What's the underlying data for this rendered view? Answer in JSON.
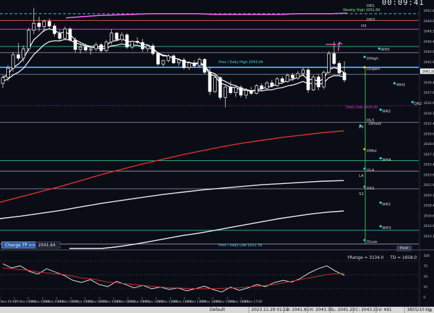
{
  "clock": "00:09:41",
  "toolbar": {
    "change_tp_label": "Change TP >>",
    "tp_value": "2041.64",
    "pivot_button": "Pivot"
  },
  "levels": [
    {
      "name": "DR1",
      "color": "#5fd0e8",
      "style": "dash",
      "price": 2051.1
    },
    {
      "name": "DH3",
      "color": "#ff6e6e",
      "style": "solid",
      "price": 2049.95
    },
    {
      "name": "H3",
      "color": "#ff66ff",
      "style": "solid",
      "price": 2048.45
    },
    {
      "name": "WH5",
      "color": "#2ee6a8",
      "style": "solid",
      "price": 2045.5
    },
    {
      "name": "DHigh",
      "color": "#9aa0b8",
      "style": "solid",
      "price": 2044.45
    },
    {
      "name": "DOpen",
      "color": "#3aa0ff",
      "style": "thick",
      "price": 2041.95
    },
    {
      "name": "L5",
      "color": "#9aa0b8",
      "style": "solid",
      "price": 2040.75
    },
    {
      "name": "Daily Low",
      "color": "#cc44cc",
      "style": "dot",
      "price": 2035.41
    },
    {
      "name": "DL3",
      "color": "#9aa0b8",
      "style": "solid",
      "price": 2032.55
    },
    {
      "name": "WH4",
      "color": "#2ee6a8",
      "style": "solid",
      "price": 2026.0
    },
    {
      "name": "DL4",
      "color": "#9aa0b8",
      "style": "solid",
      "price": 2024.2
    },
    {
      "name": "DS1",
      "color": "#9aa0b8",
      "style": "solid",
      "price": 2021.2
    },
    {
      "name": "WH3",
      "color": "#3ad8d8",
      "style": "solid",
      "price": 2014.1
    },
    {
      "name": "DLow",
      "color": "#9aa0b8",
      "style": "solid",
      "price": 2011.75
    }
  ],
  "level_labels": [
    {
      "text": "DR1",
      "color": "#d8d8d8"
    },
    {
      "text": "DH3",
      "color": "#d8d8d8"
    },
    {
      "text": "H3",
      "color": "#d8d8d8"
    },
    {
      "text": "WH5",
      "color": "#d8d8d8"
    },
    {
      "text": "DHigh",
      "color": "#d8d8d8"
    },
    {
      "text": "DOpen",
      "color": "#d8d8d8"
    },
    {
      "text": "MH3",
      "color": "#d8d8d8"
    },
    {
      "text": "QR2",
      "color": "#d8d8d8"
    },
    {
      "text": "WR2",
      "color": "#d8d8d8"
    },
    {
      "text": "DL3",
      "color": "#d8d8d8"
    },
    {
      "text": "PP",
      "color": "#d8d8d8"
    },
    {
      "text": "DPivot",
      "color": "#d8d8d8"
    },
    {
      "text": "DMid",
      "color": "#d8d8d8"
    },
    {
      "text": "WH4",
      "color": "#d8d8d8"
    },
    {
      "text": "DL4",
      "color": "#d8d8d8"
    },
    {
      "text": "L4",
      "color": "#d8d8d8"
    },
    {
      "text": "DS1",
      "color": "#d8d8d8"
    },
    {
      "text": "S1",
      "color": "#d8d8d8"
    },
    {
      "text": "WR1",
      "color": "#d8d8d8"
    },
    {
      "text": "WH3",
      "color": "#d8d8d8"
    },
    {
      "text": "DLow",
      "color": "#d8d8d8"
    }
  ],
  "annotations": {
    "weekly_high": "Weekly High 2051.80",
    "prev_daily_high": "Prev / Daily High 2043.04",
    "daily_low": "Daily Low 2035.41",
    "prev_daily_low": "Prev / Daily Low 2011.78",
    "yrange": "YRange = 3134.0",
    "td": "TD = 1658.0"
  },
  "price_axis": {
    "ticks": [
      "2051.65",
      "2049.90",
      "2048.15",
      "2046.40",
      "2044.65",
      "2042.90",
      "2041.15",
      "2039.40",
      "2037.65",
      "2035.90",
      "2034.15",
      "2032.40",
      "2030.65",
      "2028.90",
      "2027.15",
      "2025.40",
      "2023.65",
      "2021.90",
      "2020.15",
      "2018.40",
      "2016.65",
      "2014.90",
      "2013.15"
    ],
    "current_price": "2041.28"
  },
  "oscillator_axis": {
    "ticks": [
      "100",
      "75",
      "50",
      "25",
      "0"
    ]
  },
  "time_axis": {
    "labels": [
      "Nov 00:00",
      "29 Nov 01:00",
      "29 Nov 02:00",
      "29 Nov 03:00",
      "29 Nov 04:00",
      "29 Nov 05:00",
      "29 Nov 06:00",
      "29 Nov 07:00",
      "29 Nov 08:00",
      "29 Nov 09:00",
      "29 Nov 10:00",
      "29 Nov 11:00",
      "29 Nov 12:00",
      "29 Nov 13:00",
      "29 Nov 14:00",
      "29 Nov 15:00",
      "29 Nov 16:00",
      "29 Nov 17:00"
    ]
  },
  "status": {
    "profile": "Default",
    "datetime": "2023.11.29 01:15",
    "open": "O: 2041.85",
    "high": "H: 2043.35",
    "low": "L: 2041.28",
    "close": "C: 2043.21",
    "volume": "V: 491",
    "traffic": "3855/10 kb"
  },
  "colors": {
    "background": "#0b0d16",
    "candle_up": "#ffffff",
    "candle_down": "#ffffff",
    "ma_red": "#e0312b",
    "ma_white": "#f0f0f0",
    "session_open": "#22cc33"
  },
  "chart_data": {
    "type": "line",
    "title": "",
    "xlabel": "",
    "ylabel": "",
    "ylim": [
      2011.0,
      2052.5
    ],
    "candles": [
      {
        "o": 2039.2,
        "h": 2040.6,
        "l": 2038.4,
        "c": 2040.2
      },
      {
        "o": 2040.2,
        "h": 2042.3,
        "l": 2039.6,
        "c": 2041.8
      },
      {
        "o": 2041.8,
        "h": 2044.6,
        "l": 2041.2,
        "c": 2044.1
      },
      {
        "o": 2044.1,
        "h": 2046.1,
        "l": 2043.1,
        "c": 2043.5
      },
      {
        "o": 2043.5,
        "h": 2045.7,
        "l": 2042.9,
        "c": 2045.1
      },
      {
        "o": 2045.1,
        "h": 2048.7,
        "l": 2044.7,
        "c": 2048.3
      },
      {
        "o": 2048.3,
        "h": 2052.1,
        "l": 2047.6,
        "c": 2049.5
      },
      {
        "o": 2049.5,
        "h": 2050.6,
        "l": 2048.1,
        "c": 2048.9
      },
      {
        "o": 2048.9,
        "h": 2050.1,
        "l": 2048.0,
        "c": 2049.8
      },
      {
        "o": 2049.8,
        "h": 2050.3,
        "l": 2048.6,
        "c": 2049.0
      },
      {
        "o": 2049.0,
        "h": 2049.4,
        "l": 2047.2,
        "c": 2047.7
      },
      {
        "o": 2047.7,
        "h": 2048.3,
        "l": 2046.4,
        "c": 2046.9
      },
      {
        "o": 2046.9,
        "h": 2048.9,
        "l": 2046.6,
        "c": 2048.5
      },
      {
        "o": 2048.5,
        "h": 2048.8,
        "l": 2046.3,
        "c": 2046.6
      },
      {
        "o": 2046.6,
        "h": 2047.1,
        "l": 2044.5,
        "c": 2045.0
      },
      {
        "o": 2045.0,
        "h": 2046.0,
        "l": 2044.3,
        "c": 2045.4
      },
      {
        "o": 2045.4,
        "h": 2046.0,
        "l": 2044.6,
        "c": 2044.9
      },
      {
        "o": 2044.9,
        "h": 2045.4,
        "l": 2044.1,
        "c": 2045.1
      },
      {
        "o": 2045.1,
        "h": 2046.2,
        "l": 2044.7,
        "c": 2045.8
      },
      {
        "o": 2045.8,
        "h": 2046.1,
        "l": 2044.5,
        "c": 2044.8
      },
      {
        "o": 2044.8,
        "h": 2046.6,
        "l": 2044.6,
        "c": 2046.3
      },
      {
        "o": 2046.3,
        "h": 2048.4,
        "l": 2045.9,
        "c": 2047.8
      },
      {
        "o": 2047.8,
        "h": 2048.0,
        "l": 2046.4,
        "c": 2046.7
      },
      {
        "o": 2046.7,
        "h": 2047.9,
        "l": 2046.3,
        "c": 2047.5
      },
      {
        "o": 2047.5,
        "h": 2047.8,
        "l": 2045.1,
        "c": 2045.4
      },
      {
        "o": 2045.4,
        "h": 2046.6,
        "l": 2045.1,
        "c": 2046.4
      },
      {
        "o": 2046.4,
        "h": 2047.1,
        "l": 2045.9,
        "c": 2046.2
      },
      {
        "o": 2046.2,
        "h": 2046.8,
        "l": 2044.6,
        "c": 2045.1
      },
      {
        "o": 2045.1,
        "h": 2045.8,
        "l": 2044.6,
        "c": 2045.6
      },
      {
        "o": 2045.6,
        "h": 2046.0,
        "l": 2044.0,
        "c": 2044.3
      },
      {
        "o": 2044.3,
        "h": 2044.6,
        "l": 2042.2,
        "c": 2042.5
      },
      {
        "o": 2042.5,
        "h": 2043.3,
        "l": 2042.1,
        "c": 2043.1
      },
      {
        "o": 2043.1,
        "h": 2044.2,
        "l": 2042.8,
        "c": 2043.9
      },
      {
        "o": 2043.9,
        "h": 2044.2,
        "l": 2042.5,
        "c": 2042.7
      },
      {
        "o": 2042.7,
        "h": 2043.4,
        "l": 2042.2,
        "c": 2043.2
      },
      {
        "o": 2043.2,
        "h": 2043.6,
        "l": 2041.6,
        "c": 2041.9
      },
      {
        "o": 2041.9,
        "h": 2043.0,
        "l": 2041.5,
        "c": 2042.7
      },
      {
        "o": 2042.7,
        "h": 2043.2,
        "l": 2041.9,
        "c": 2042.2
      },
      {
        "o": 2042.2,
        "h": 2043.6,
        "l": 2041.9,
        "c": 2043.3
      },
      {
        "o": 2043.3,
        "h": 2043.5,
        "l": 2040.8,
        "c": 2041.1
      },
      {
        "o": 2041.1,
        "h": 2041.9,
        "l": 2037.2,
        "c": 2037.8
      },
      {
        "o": 2037.8,
        "h": 2040.6,
        "l": 2037.6,
        "c": 2040.2
      },
      {
        "o": 2040.2,
        "h": 2040.4,
        "l": 2036.4,
        "c": 2036.8
      },
      {
        "o": 2036.8,
        "h": 2038.9,
        "l": 2035.1,
        "c": 2038.6
      },
      {
        "o": 2038.6,
        "h": 2039.6,
        "l": 2037.3,
        "c": 2037.6
      },
      {
        "o": 2037.6,
        "h": 2038.8,
        "l": 2036.9,
        "c": 2038.5
      },
      {
        "o": 2038.5,
        "h": 2038.9,
        "l": 2036.8,
        "c": 2037.2
      },
      {
        "o": 2037.2,
        "h": 2038.4,
        "l": 2036.6,
        "c": 2038.0
      },
      {
        "o": 2038.0,
        "h": 2038.6,
        "l": 2037.2,
        "c": 2037.5
      },
      {
        "o": 2037.5,
        "h": 2039.1,
        "l": 2037.3,
        "c": 2038.8
      },
      {
        "o": 2038.8,
        "h": 2039.2,
        "l": 2037.9,
        "c": 2038.3
      },
      {
        "o": 2038.3,
        "h": 2039.6,
        "l": 2038.0,
        "c": 2039.3
      },
      {
        "o": 2039.3,
        "h": 2039.8,
        "l": 2038.5,
        "c": 2038.8
      },
      {
        "o": 2038.8,
        "h": 2040.3,
        "l": 2038.6,
        "c": 2040.0
      },
      {
        "o": 2040.0,
        "h": 2040.4,
        "l": 2039.1,
        "c": 2039.5
      },
      {
        "o": 2039.5,
        "h": 2040.9,
        "l": 2039.3,
        "c": 2040.6
      },
      {
        "o": 2040.6,
        "h": 2041.0,
        "l": 2039.6,
        "c": 2040.1
      },
      {
        "o": 2040.1,
        "h": 2041.3,
        "l": 2039.8,
        "c": 2040.9
      },
      {
        "o": 2040.9,
        "h": 2041.9,
        "l": 2040.4,
        "c": 2041.5
      },
      {
        "o": 2041.5,
        "h": 2041.8,
        "l": 2037.6,
        "c": 2038.1
      },
      {
        "o": 2038.1,
        "h": 2040.6,
        "l": 2037.9,
        "c": 2040.3
      },
      {
        "o": 2040.3,
        "h": 2040.8,
        "l": 2038.0,
        "c": 2038.6
      },
      {
        "o": 2038.6,
        "h": 2041.4,
        "l": 2038.2,
        "c": 2041.1
      },
      {
        "o": 2041.1,
        "h": 2044.7,
        "l": 2040.9,
        "c": 2044.3
      },
      {
        "o": 2044.3,
        "h": 2046.3,
        "l": 2042.3,
        "c": 2042.6
      },
      {
        "o": 2042.6,
        "h": 2043.0,
        "l": 2040.6,
        "c": 2041.0
      },
      {
        "o": 2041.0,
        "h": 2043.0,
        "l": 2039.4,
        "c": 2039.8
      }
    ],
    "series": [
      {
        "values": [
          2050.4,
          2050.6,
          2050.8,
          2050.9,
          2051.0,
          2051.1,
          2051.1,
          2051.1,
          2051.1,
          2051.0,
          2051.0,
          2051.0,
          2051.0,
          2051.0,
          2051.1,
          2051.1,
          2051.1,
          2051.2
        ]
      },
      {
        "values": [
          2018.9,
          2019.8,
          2020.7,
          2021.6,
          2022.6,
          2023.6,
          2024.5,
          2025.4,
          2026.2,
          2027.0,
          2027.7,
          2028.4,
          2029.0,
          2029.5,
          2030.0,
          2030.4,
          2030.8,
          2031.1
        ]
      },
      {
        "values": [
          2016.1,
          2016.5,
          2017.0,
          2017.5,
          2018.1,
          2018.7,
          2019.2,
          2019.7,
          2020.2,
          2020.6,
          2021.0,
          2021.3,
          2021.6,
          2021.9,
          2022.1,
          2022.3,
          2022.5,
          2022.6
        ]
      },
      {
        "values": [
          2011.0,
          2011.0,
          2011.0,
          2011.3,
          2011.7,
          2012.2,
          2012.7,
          2013.2,
          2013.6,
          2014.1,
          2014.6,
          2015.1,
          2015.6,
          2016.1,
          2016.5,
          2016.9,
          2017.2,
          2017.4
        ]
      }
    ],
    "oscillator": {
      "ylim": [
        0,
        100
      ],
      "white": [
        80,
        70,
        75,
        62,
        55,
        68,
        60,
        52,
        40,
        35,
        42,
        30,
        25,
        38,
        30,
        22,
        28,
        20,
        24,
        18,
        22,
        15,
        20,
        26,
        18,
        12,
        24,
        16,
        22,
        30,
        25,
        35,
        40,
        36,
        45,
        58,
        68,
        75,
        62,
        52
      ],
      "red": [
        70,
        68,
        66,
        64,
        60,
        58,
        56,
        54,
        50,
        46,
        44,
        40,
        36,
        34,
        32,
        30,
        28,
        26,
        24,
        22,
        22,
        21,
        20,
        20,
        20,
        21,
        22,
        22,
        24,
        26,
        28,
        30,
        34,
        38,
        42,
        46,
        50,
        54,
        56,
        57
      ]
    }
  }
}
